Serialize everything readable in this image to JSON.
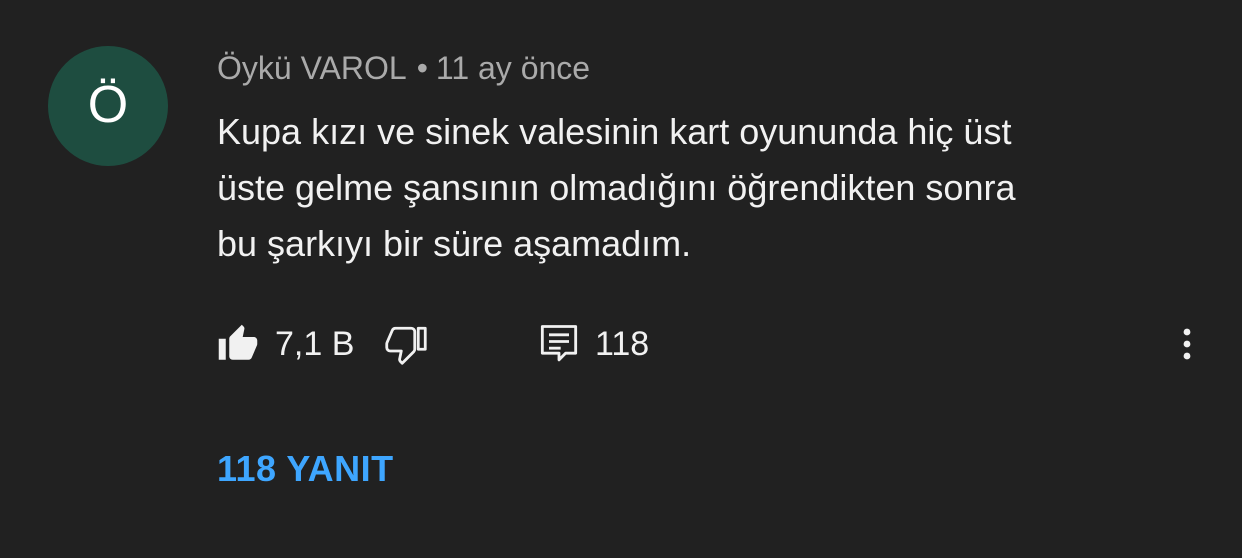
{
  "comment": {
    "avatar_letter": "Ö",
    "avatar_color": "#1e4d40",
    "author": "Öykü VAROL",
    "separator": "•",
    "time": "11 ay önce",
    "text_lines": [
      "Kupa kızı ve sinek valesinin kart oyununda hiç üst",
      "üste gelme şansının olmadığını öğrendikten sonra",
      "bu şarkıyı bir süre aşamadım."
    ],
    "like_icon": "thumbs-up-filled-icon",
    "like_count": "7,1 B",
    "dislike_icon": "thumbs-down-outline-icon",
    "reply_icon": "comment-reply-icon",
    "reply_count": "118",
    "more_icon": "more-vertical-icon",
    "replies_link": "118 YANIT",
    "replies_link_color": "#3ea6ff"
  }
}
